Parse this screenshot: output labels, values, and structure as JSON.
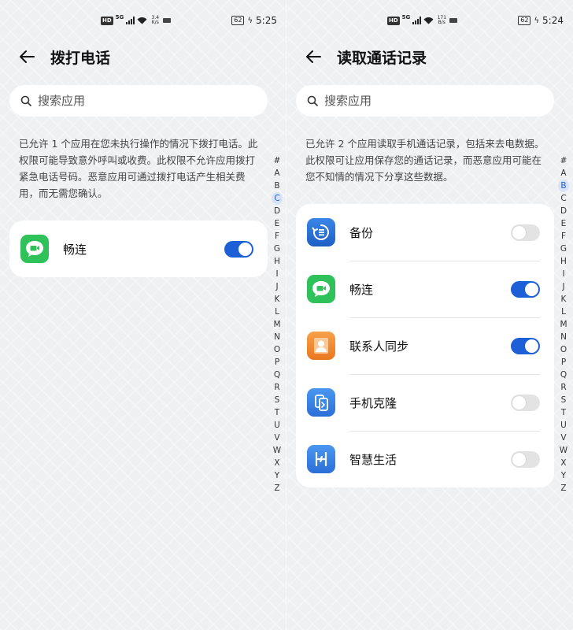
{
  "status": {
    "network": "5G",
    "left_speed": [
      "3.4",
      "K/s"
    ],
    "right_speed": [
      "171",
      "B/s"
    ],
    "battery": "62",
    "left_time": "5:25",
    "right_time": "5:24"
  },
  "left": {
    "title": "拨打电话",
    "search_placeholder": "搜索应用",
    "description": "已允许 1 个应用在您未执行操作的情况下拨打电话。此权限可能导致意外呼叫或收费。此权限不允许应用拨打紧急电话号码。恶意应用可通过拨打电话产生相关费用，而无需您确认。",
    "apps": [
      {
        "name": "畅连",
        "icon": "changlian-icon",
        "enabled": true
      }
    ],
    "active_letter": "C"
  },
  "right": {
    "title": "读取通话记录",
    "search_placeholder": "搜索应用",
    "description": "已允许 2 个应用读取手机通话记录，包括来去电数据。此权限可让应用保存您的通话记录，而恶意应用可能在您不知情的情况下分享这些数据。",
    "apps": [
      {
        "name": "备份",
        "icon": "backup-icon",
        "enabled": false
      },
      {
        "name": "畅连",
        "icon": "changlian-icon",
        "enabled": true
      },
      {
        "name": "联系人同步",
        "icon": "contacts-sync-icon",
        "enabled": true
      },
      {
        "name": "手机克隆",
        "icon": "phone-clone-icon",
        "enabled": false
      },
      {
        "name": "智慧生活",
        "icon": "smart-life-icon",
        "enabled": false
      }
    ],
    "active_letter": "B"
  },
  "alphabet": [
    "#",
    "A",
    "B",
    "C",
    "D",
    "E",
    "F",
    "G",
    "H",
    "I",
    "J",
    "K",
    "L",
    "M",
    "N",
    "O",
    "P",
    "Q",
    "R",
    "S",
    "T",
    "U",
    "V",
    "W",
    "X",
    "Y",
    "Z"
  ],
  "colors": {
    "accent": "#1d5fd6",
    "toggle_off": "#e3e3e3",
    "changlian": "#2fc25b",
    "backup": "#1f6bd1",
    "contacts": "#f08a2c",
    "clone": "#2f7fe6",
    "smart_life": "#2f7fe6"
  }
}
